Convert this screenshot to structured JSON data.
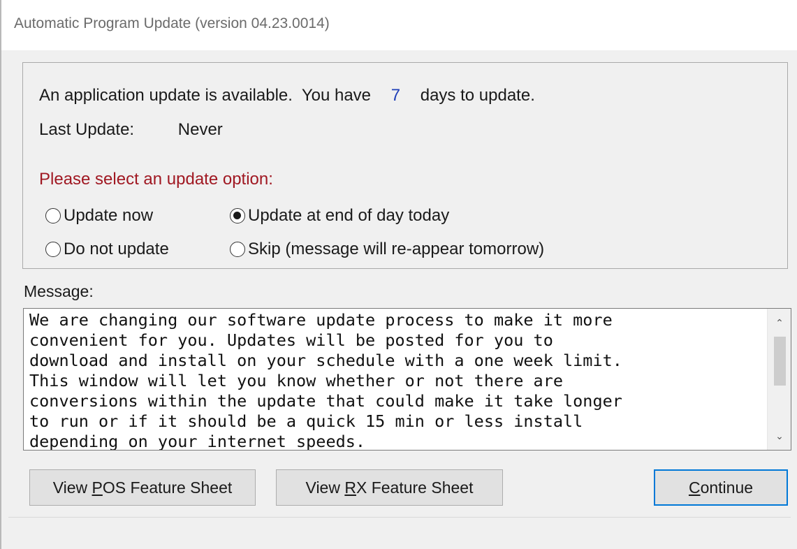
{
  "window": {
    "title": "Automatic Program Update (version 04.23.0014)"
  },
  "info": {
    "available_prefix": "An application update is available.  You have",
    "days": "7",
    "available_suffix": "days to update.",
    "last_update_label": "Last Update:",
    "last_update_value": "Never",
    "prompt": "Please select an update option:"
  },
  "options": [
    {
      "label": "Update now",
      "checked": false
    },
    {
      "label": "Update at end of day today",
      "checked": true
    },
    {
      "label": "Do not update",
      "checked": false
    },
    {
      "label": "Skip (message will re-appear tomorrow)",
      "checked": false
    }
  ],
  "message": {
    "label": "Message:",
    "text": "We are changing our software update process to make it more\nconvenient for you. Updates will be posted for you to\ndownload and install on your schedule with a one week limit.\nThis window will let you know whether or not there are\nconversions within the update that could make it take longer\nto run or if it should be a quick 15 min or less install\ndepending on your internet speeds."
  },
  "buttons": {
    "pos_pre": "View ",
    "pos_key": "P",
    "pos_post": "OS Feature Sheet",
    "rx_pre": "View ",
    "rx_key": "R",
    "rx_post": "X Feature Sheet",
    "continue_pre": "",
    "continue_key": "C",
    "continue_post": "ontinue"
  },
  "icons": {
    "scroll_up": "chevron-up-icon",
    "scroll_down": "chevron-down-icon"
  }
}
